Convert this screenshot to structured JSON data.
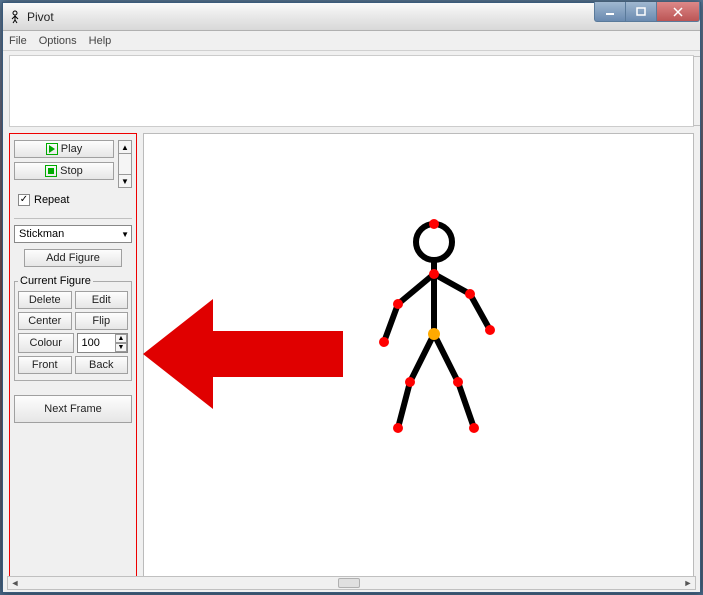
{
  "window": {
    "title": "Pivot"
  },
  "menu": {
    "file": "File",
    "options": "Options",
    "help": "Help"
  },
  "controls": {
    "play": "Play",
    "stop": "Stop",
    "repeat_label": "Repeat",
    "repeat_checked": true
  },
  "figure_select": {
    "value": "Stickman",
    "add_figure": "Add Figure"
  },
  "current_figure": {
    "legend": "Current Figure",
    "delete": "Delete",
    "edit": "Edit",
    "center": "Center",
    "flip": "Flip",
    "colour": "Colour",
    "scale_value": "100",
    "front": "Front",
    "back": "Back"
  },
  "next_frame": "Next Frame",
  "annotation": {
    "arrow_color": "#e00000"
  },
  "stickman": {
    "stroke": "#000000",
    "joint_fill": "#ff0000",
    "pivot_fill": "#ffaa00"
  }
}
